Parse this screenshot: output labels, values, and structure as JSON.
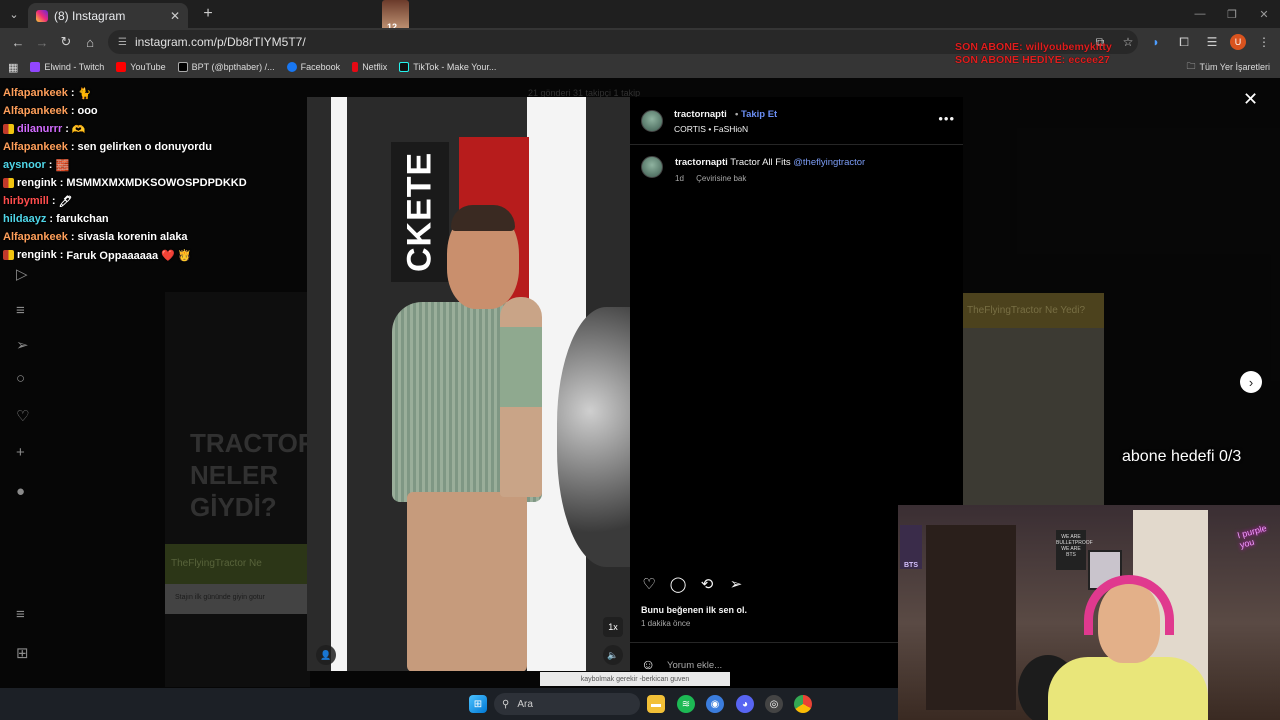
{
  "browser": {
    "tab_title": "(8) Instagram",
    "url": "instagram.com/p/Db8rTIYM5T7/",
    "bookmarks": [
      "Elwind - Twitch",
      "YouTube",
      "BPT (@bpthaber) /...",
      "Facebook",
      "Netflix",
      "TikTok - Make Your..."
    ],
    "bookmarks_right": "Tüm Yer İşaretleri",
    "profile_initial": "U"
  },
  "alerts": {
    "line1": "SON ABONE: willyoubemykitty",
    "line2": "SON ABONE HEDİYE: eccee27"
  },
  "chat": [
    {
      "user": "Alfapankeek",
      "color": "#ff9f5a",
      "msg": "🐈",
      "badges": false
    },
    {
      "user": "Alfapankeek",
      "color": "#ff9f5a",
      "msg": "ooo",
      "badges": false
    },
    {
      "user": "dilanurrr",
      "color": "#d36cff",
      "msg": "🫶",
      "badges": true
    },
    {
      "user": "Alfapankeek",
      "color": "#ff9f5a",
      "msg": "sen gelirken o donuyordu",
      "badges": false
    },
    {
      "user": "aysnoor",
      "color": "#4fd6e8",
      "msg": "🧱",
      "badges": false
    },
    {
      "user": "rengink",
      "color": "#ffffff",
      "msg": "MSMMXMXMDKSOWOSPDPDKKD",
      "badges": true
    },
    {
      "user": "hirbymill",
      "color": "#ff4d4d",
      "msg": "🖊",
      "badges": false
    },
    {
      "user": "hildaayz",
      "color": "#4fd6e8",
      "msg": "farukchan",
      "badges": false
    },
    {
      "user": "Alfapankeek",
      "color": "#ff9f5a",
      "msg": "sivasla korenin alaka",
      "badges": false
    },
    {
      "user": "rengink",
      "color": "#ffffff",
      "msg": "Faruk Oppaaaaaa ❤️ 🫅",
      "badges": true
    }
  ],
  "background": {
    "grid_stats": "21 gönderi   31 takipçi   1 takip",
    "left_post_text": "TRACTOR NELER GİYDİ?",
    "left_post_banner": "TheFlyingTractor Ne",
    "left_post_sub": "Stajın ilk gününde giyin gotur",
    "right_post_title": "TheFlyingTractor Ne Yedi?"
  },
  "post": {
    "collage_text": "CKETE",
    "author": "tractornapti",
    "follow_label": "Takip Et",
    "audio": "CORTIS • FaSHioN",
    "caption_user": "tractornapti",
    "caption_text": "Tractor All Fits",
    "caption_mention": "@theflyingtractor",
    "age": "1d",
    "translate": "Çevirisine bak",
    "likes_text": "Bunu beğenen ilk sen ol.",
    "time_ago": "1 dakika önce",
    "comment_placeholder": "Yorum ekle...",
    "media_speed": "1x"
  },
  "overlay": {
    "sub_goal": "abone hedefi 0/3",
    "taskbar_caption": "kaybolmak gerekir -berkican guven"
  },
  "webcam": {
    "bts_label": "BTS",
    "neon": "I purple you",
    "sign": "WE ARE BULLETPROOF WE ARE BTS"
  },
  "taskbar": {
    "search_label": "Ara"
  }
}
